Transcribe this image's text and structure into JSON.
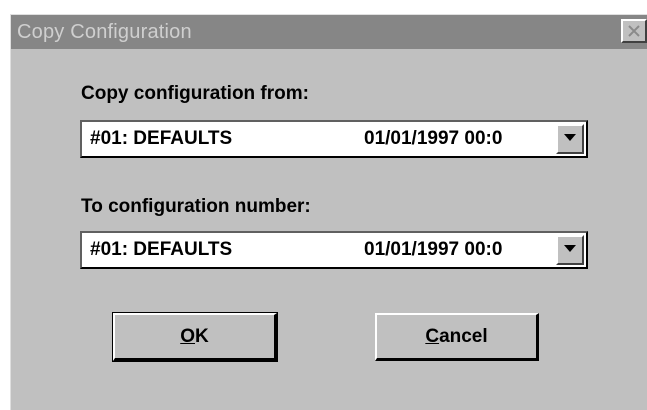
{
  "window": {
    "title": "Copy Configuration",
    "close_icon": "close-icon"
  },
  "source": {
    "label": "Copy configuration from:",
    "selected_name": "#01: DEFAULTS",
    "selected_date": "01/01/1997 00:0",
    "dropdown_icon": "chevron-down-icon"
  },
  "target": {
    "label": "To configuration number:",
    "selected_name": "#01: DEFAULTS",
    "selected_date": "01/01/1997 00:0",
    "dropdown_icon": "chevron-down-icon"
  },
  "buttons": {
    "ok_mnemonic": "O",
    "ok_rest": "K",
    "cancel_mnemonic": "C",
    "cancel_rest": "ancel"
  },
  "colors": {
    "titlebar_inactive": "#868686",
    "title_text": "#cfcfcf",
    "dialog_face": "#c0c0c0"
  }
}
